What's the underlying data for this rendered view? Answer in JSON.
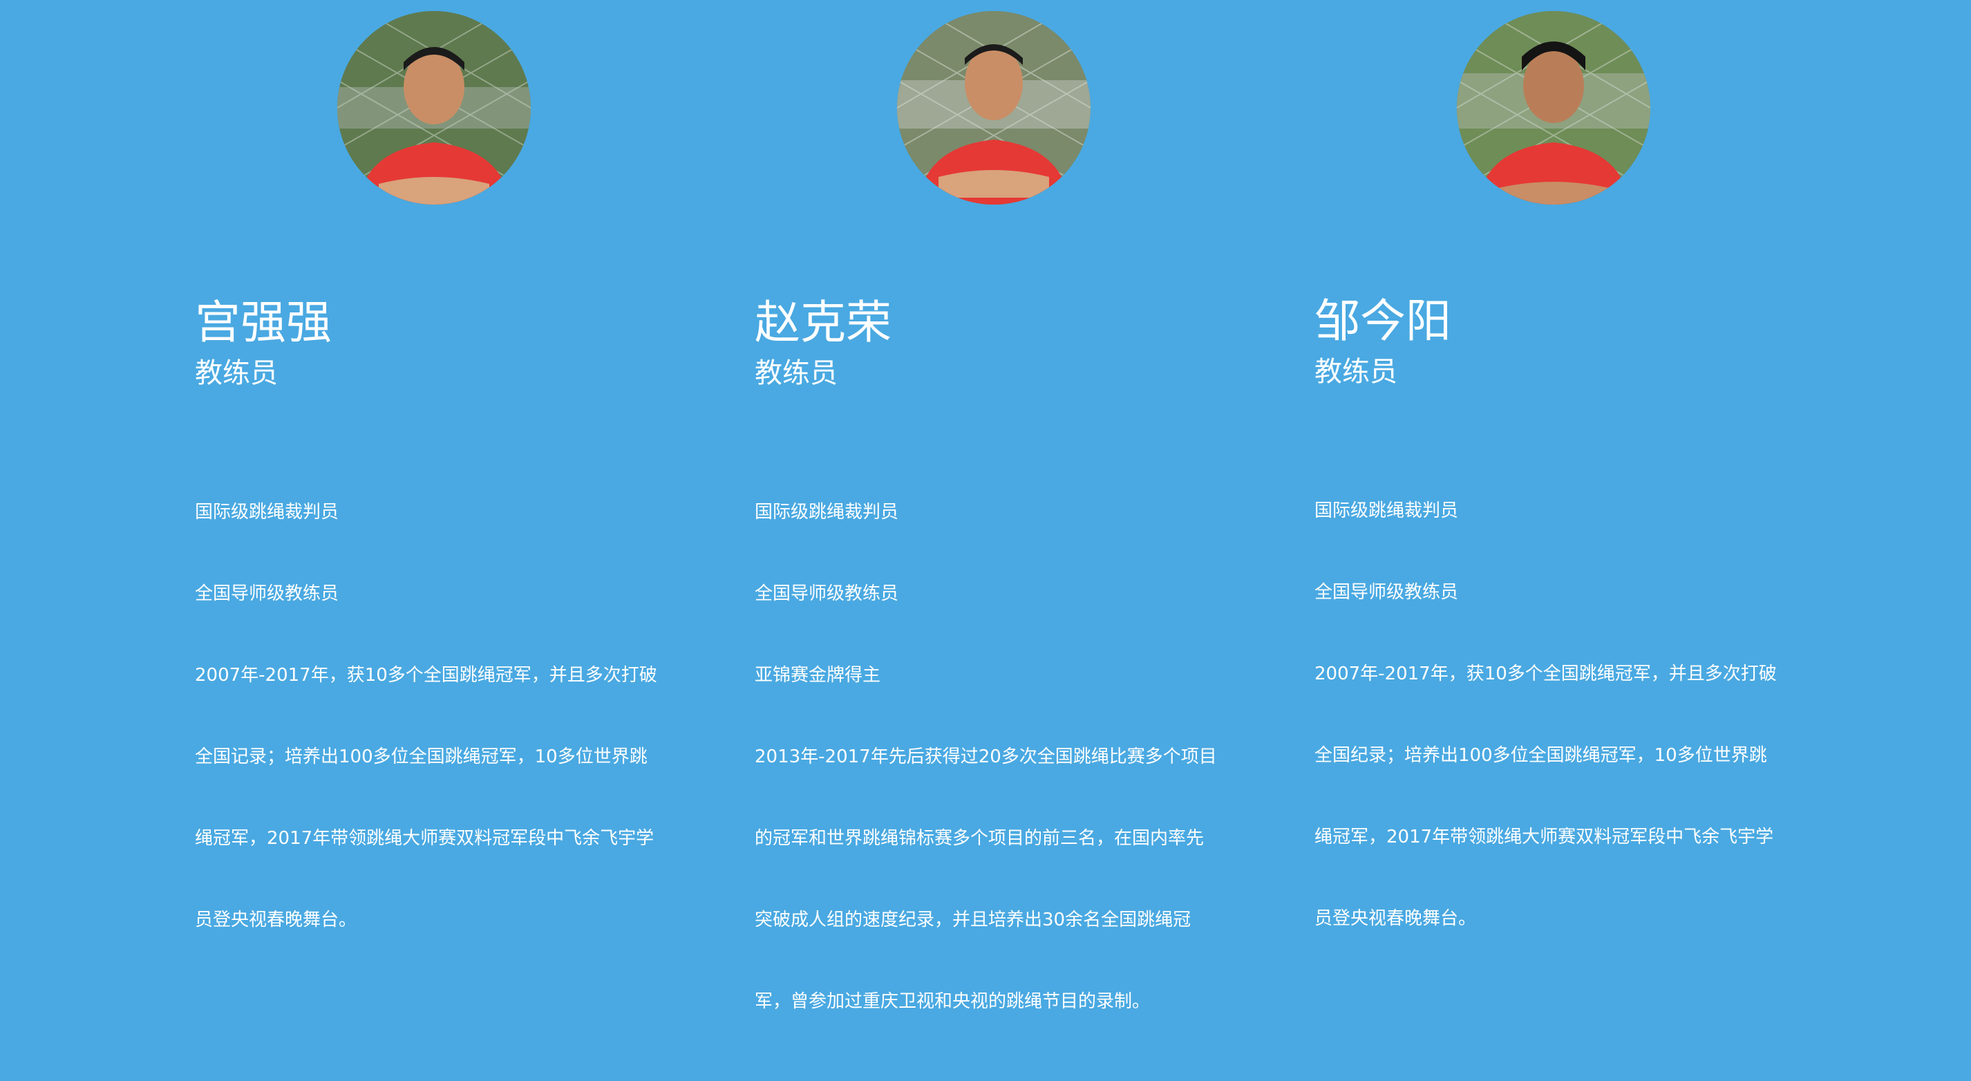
{
  "page": {
    "background": "#4aa9e2",
    "text_color": "#ffffff"
  },
  "coaches": [
    {
      "name": "宫强强",
      "role": "教练员",
      "avatar_icon": "coach-photo-icon",
      "bio": [
        "国际级跳绳裁判员",
        "全国导师级教练员",
        "2007年-2017年，获10多个全国跳绳冠军，并且多次打破",
        "全国记录；培养出100多位全国跳绳冠军，10多位世界跳",
        "绳冠军，2017年带领跳绳大师赛双料冠军段中飞余飞宇学",
        "员登央视春晚舞台。"
      ]
    },
    {
      "name": "赵克荣",
      "role": "教练员",
      "avatar_icon": "coach-photo-icon",
      "bio": [
        "国际级跳绳裁判员",
        "全国导师级教练员",
        "亚锦赛金牌得主",
        "2013年-2017年先后获得过20多次全国跳绳比赛多个项目",
        "的冠军和世界跳绳锦标赛多个项目的前三名，在国内率先",
        "突破成人组的速度纪录，并且培养出30余名全国跳绳冠",
        "军，曾参加过重庆卫视和央视的跳绳节目的录制。"
      ]
    },
    {
      "name": "邹今阳",
      "role": "教练员",
      "avatar_icon": "coach-photo-icon",
      "bio": [
        "国际级跳绳裁判员",
        "全国导师级教练员",
        "2007年-2017年，获10多个全国跳绳冠军，并且多次打破",
        "全国纪录；培养出100多位全国跳绳冠军，10多位世界跳",
        "绳冠军，2017年带领跳绳大师赛双料冠军段中飞余飞宇学",
        "员登央视春晚舞台。"
      ]
    }
  ]
}
